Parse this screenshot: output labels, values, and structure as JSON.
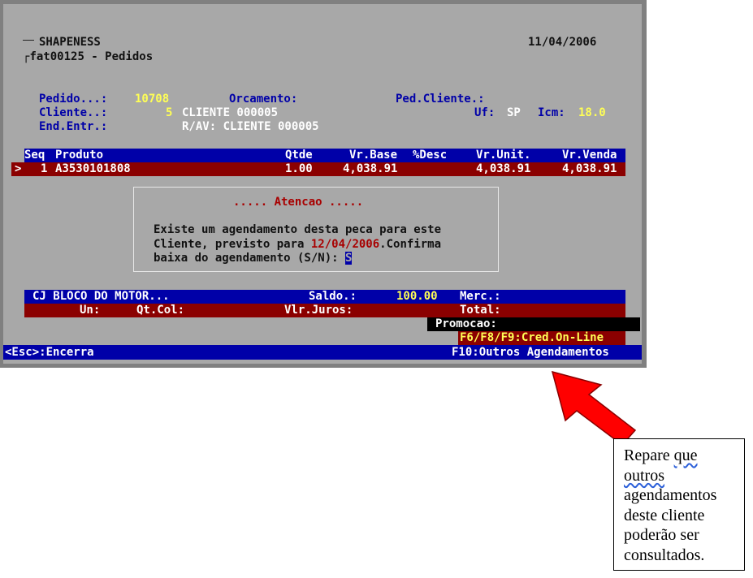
{
  "header": {
    "company": "SHAPENESS",
    "program": "fat00125 - Pedidos",
    "date": "11/04/2006"
  },
  "order": {
    "pedido_label": "Pedido...:",
    "pedido_value": "10708",
    "orcamento_label": "Orcamento:",
    "ped_cliente_label": "Ped.Cliente.:",
    "cliente_label": "Cliente..:",
    "cliente_code": "5",
    "cliente_name": "CLIENTE 000005",
    "uf_label": "Uf:",
    "uf_value": "SP",
    "icm_label": "Icm:",
    "icm_value": "18.0",
    "end_label": "End.Entr.:",
    "end_value": "R/AV: CLIENTE 000005"
  },
  "table": {
    "headers": {
      "seq": "Seq",
      "produto": "Produto",
      "qtde": "Qtde",
      "vr_base": "Vr.Base",
      "desc": "%Desc",
      "vr_unit": "Vr.Unit.",
      "vr_venda": "Vr.Venda"
    },
    "rows": [
      {
        "marker": ">",
        "seq": "1",
        "produto": "A3530101808",
        "qtde": "1.00",
        "vr_base": "4,038.91",
        "vr_unit": "4,038.91",
        "vr_venda": "4,038.91"
      }
    ]
  },
  "dialog": {
    "title": "..... Atencao .....",
    "line1": "Existe um agendamento desta peca para este",
    "line2_prefix": "Cliente, previsto para ",
    "line2_date": "12/04/2006",
    "line2_suffix": ".Confirma",
    "line3": "baixa do agendamento (S/N): ",
    "input_value": "S"
  },
  "footer_info": {
    "desc": "CJ BLOCO DO MOTOR...",
    "saldo_label": "Saldo.:",
    "saldo_value": "100.00",
    "merc_label": "Merc.:",
    "un_label": "Un:",
    "qtcol_label": "Qt.Col:",
    "juros_label": "Vlr.Juros:",
    "total_label": "Total:",
    "promocao_label": "Promocao:",
    "keys_label": "F6/F8/F9:Cred.On-Line"
  },
  "statusbar": {
    "esc": "<Esc>:Encerra",
    "f10": "F10:Outros Agendamentos"
  },
  "annotation": {
    "w1": "Repare",
    "w2": "que",
    "w3": "outros",
    "line2": "agendamentos",
    "line3": "deste cliente",
    "line4": "poderão ser",
    "line5": "consultados."
  },
  "colors": {
    "arrow": "#ff0000",
    "terminal_blue": "#0000a8",
    "terminal_red": "#8b0000",
    "terminal_yellow": "#ffff55"
  }
}
